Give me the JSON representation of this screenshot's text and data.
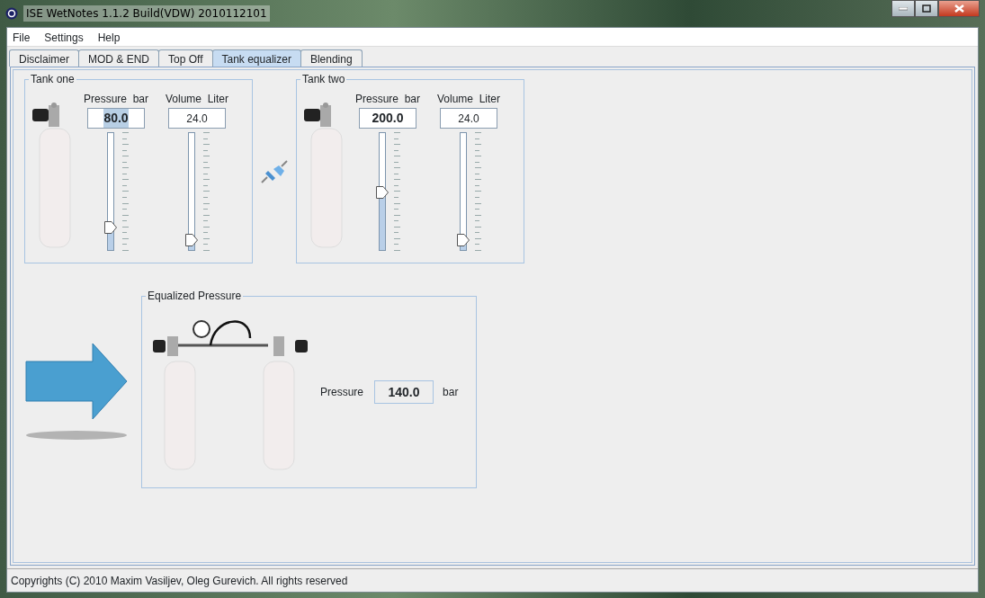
{
  "window": {
    "title": "ISE WetNotes 1.1.2 Build(VDW) 2010112101"
  },
  "menu": [
    "File",
    "Settings",
    "Help"
  ],
  "tabs": [
    {
      "label": "Disclaimer",
      "selected": false
    },
    {
      "label": "MOD & END",
      "selected": false
    },
    {
      "label": "Top Off",
      "selected": false
    },
    {
      "label": "Tank equalizer",
      "selected": true
    },
    {
      "label": "Blending",
      "selected": false
    }
  ],
  "tanks": [
    {
      "title": "Tank one",
      "pressure_label": "Pressure  bar",
      "volume_label": "Volume  Liter",
      "pressure": "80.0",
      "pressure_selected": true,
      "volume": "24.0",
      "pressure_slider": {
        "level": 0.2
      },
      "volume_slider": {
        "level": 0.09
      }
    },
    {
      "title": "Tank two",
      "pressure_label": "Pressure  bar",
      "volume_label": "Volume  Liter",
      "pressure": "200.0",
      "pressure_selected": false,
      "volume": "24.0",
      "pressure_slider": {
        "level": 0.49
      },
      "volume_slider": {
        "level": 0.09
      }
    }
  ],
  "equalized": {
    "title": "Equalized Pressure",
    "label": "Pressure",
    "value": "140.0",
    "unit": "bar"
  },
  "status_bar": "Copyrights (C) 2010 Maxim Vasiljev, Oleg Gurevich. All rights reserved"
}
